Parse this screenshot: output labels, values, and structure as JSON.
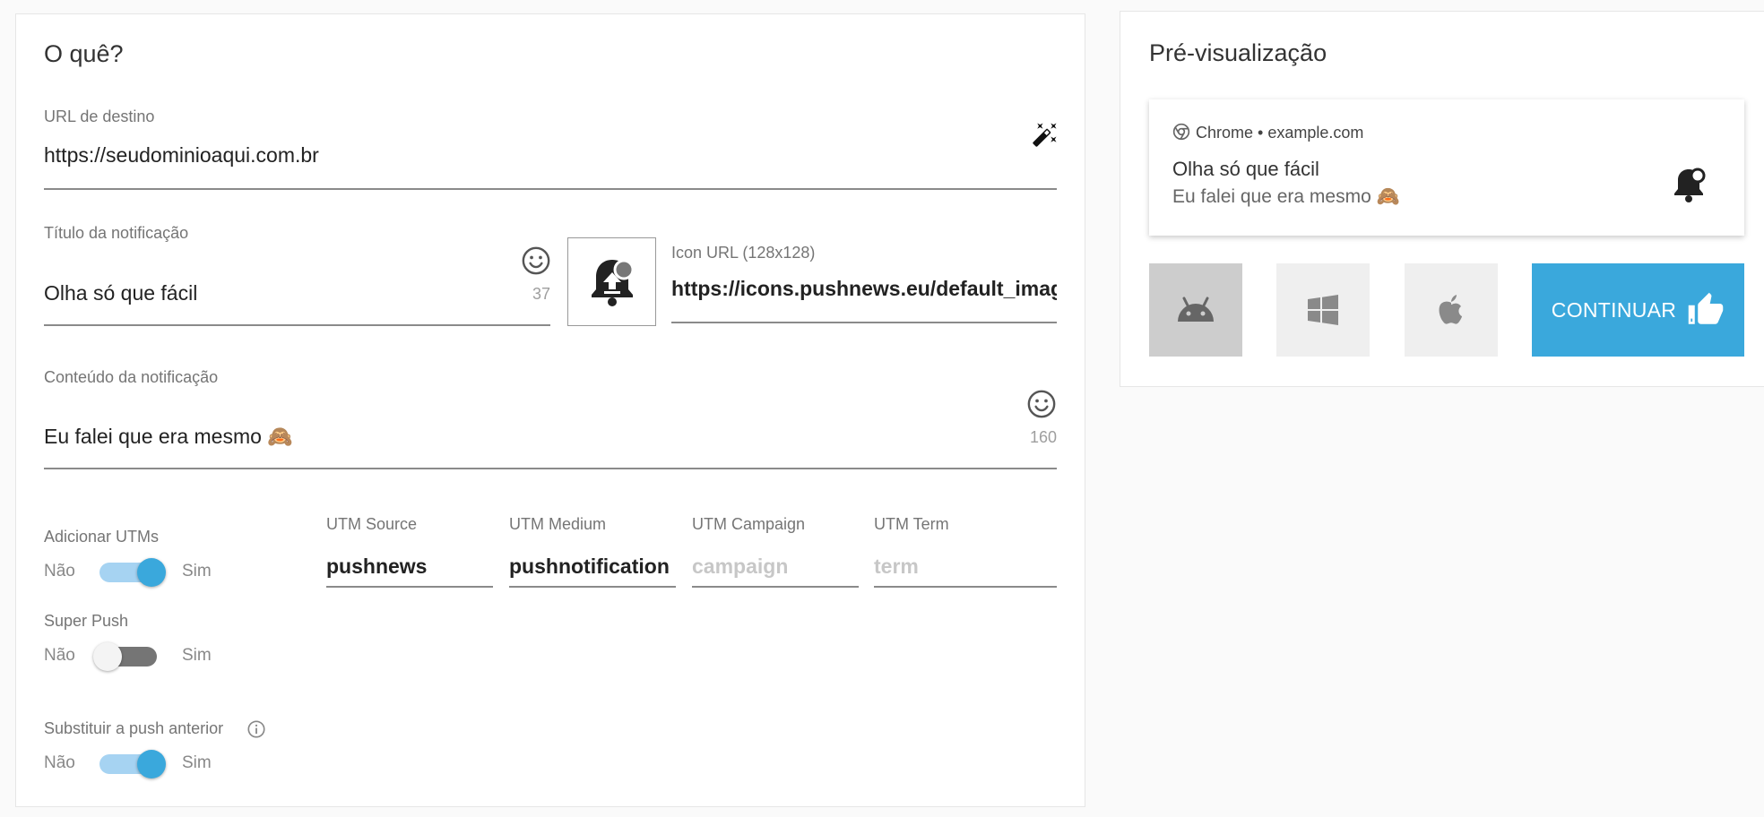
{
  "left": {
    "heading": "O quê?",
    "url_field": {
      "label": "URL de destino",
      "value": "https://seudominioaqui.com.br"
    },
    "title_field": {
      "label": "Título da notificação",
      "value": "Olha só que fácil",
      "counter": "37"
    },
    "icon_field": {
      "label": "Icon URL (128x128)",
      "value": "https://icons.pushnews.eu/default_images/"
    },
    "content_field": {
      "label": "Conteúdo da notificação",
      "value": "Eu falei que era mesmo 🙈",
      "counter": "160"
    },
    "utm_toggle": {
      "label": "Adicionar UTMs",
      "off": "Não",
      "on": "Sim",
      "checked": true
    },
    "superpush_toggle": {
      "label": "Super Push",
      "off": "Não",
      "on": "Sim",
      "checked": false
    },
    "replace_toggle": {
      "label": "Substituir a push anterior",
      "off": "Não",
      "on": "Sim",
      "checked": true
    },
    "utm_source": {
      "label": "UTM Source",
      "value": "pushnews"
    },
    "utm_medium": {
      "label": "UTM Medium",
      "value": "pushnotification"
    },
    "utm_campaign": {
      "label": "UTM Campaign",
      "placeholder": "campaign"
    },
    "utm_term": {
      "label": "UTM Term",
      "placeholder": "term"
    }
  },
  "right": {
    "heading": "Pré-visualização",
    "preview": {
      "source": "Chrome • example.com",
      "title": "Olha só que fácil",
      "body": "Eu falei que era mesmo 🙈"
    },
    "continue_label": "CONTINUAR"
  },
  "colors": {
    "accent": "#3aa8dc",
    "toggle_track_on": "#a6d3f2",
    "toggle_track_off": "#757575",
    "android_bg": "#cdcdcd",
    "os_bg": "#efefef"
  }
}
